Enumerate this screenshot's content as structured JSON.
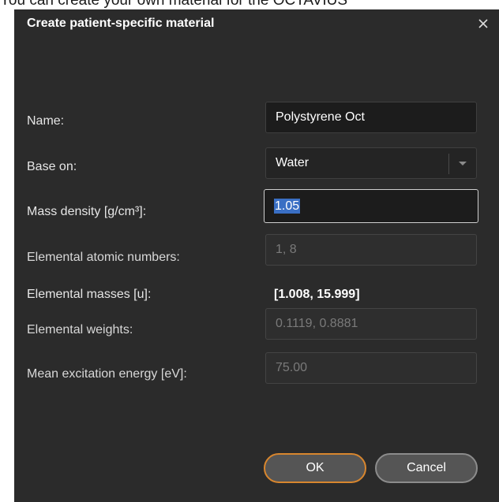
{
  "page_caption": "You can create your own material for the OCTAVIUS",
  "dialog": {
    "title": "Create patient-specific material"
  },
  "fields": {
    "name": {
      "label": "Name:",
      "value": "Polystyrene Oct"
    },
    "base_on": {
      "label": "Base on:",
      "value": "Water"
    },
    "mass_density": {
      "label": "Mass density [g/cm³]:",
      "value": "1.05"
    },
    "atomic_numbers": {
      "label": "Elemental atomic numbers:",
      "value": "1, 8"
    },
    "masses": {
      "label": "Elemental masses [u]:",
      "value": "[1.008, 15.999]"
    },
    "weights": {
      "label": "Elemental weights:",
      "value": "0.1119, 0.8881"
    },
    "excitation": {
      "label": "Mean excitation energy [eV]:",
      "value": "75.00"
    }
  },
  "buttons": {
    "ok": "OK",
    "cancel": "Cancel"
  },
  "icons": {
    "close": "close-icon",
    "dropdown": "chevron-down-icon"
  },
  "colors": {
    "dialog_bg": "#2b2b2b",
    "ok_border": "#d8862e",
    "selection": "#3a6fc4"
  }
}
